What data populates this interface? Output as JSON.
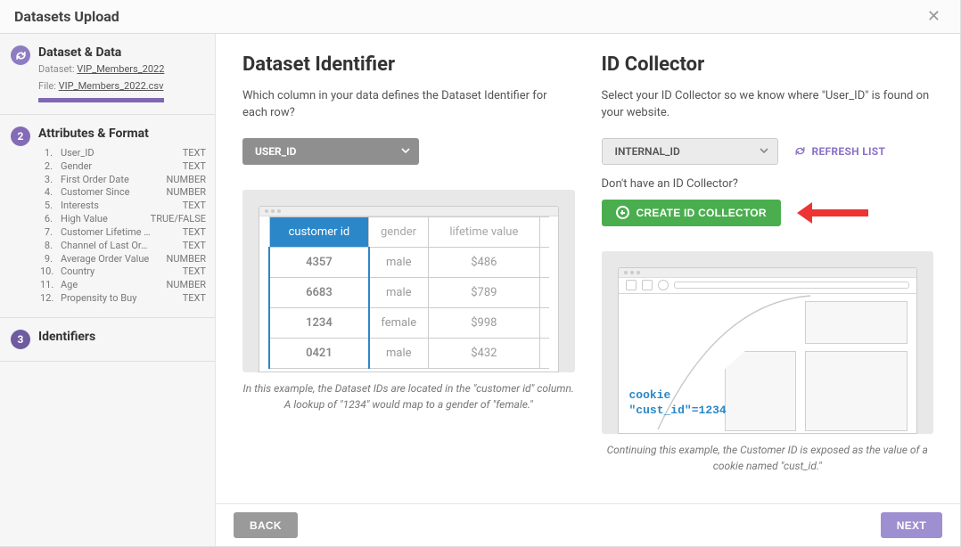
{
  "header": {
    "title": "Datasets Upload"
  },
  "sidebar": {
    "step1": {
      "title": "Dataset & Data",
      "dataset_label": "Dataset:",
      "dataset_value": "VIP_Members_2022",
      "file_label": "File:",
      "file_value": "VIP_Members_2022.csv"
    },
    "step2": {
      "title": "Attributes & Format",
      "number": "2",
      "attributes": [
        {
          "n": "1.",
          "name": "User_ID",
          "type": "TEXT"
        },
        {
          "n": "2.",
          "name": "Gender",
          "type": "TEXT"
        },
        {
          "n": "3.",
          "name": "First Order Date",
          "type": "NUMBER"
        },
        {
          "n": "4.",
          "name": "Customer Since",
          "type": "NUMBER"
        },
        {
          "n": "5.",
          "name": "Interests",
          "type": "TEXT"
        },
        {
          "n": "6.",
          "name": "High Value",
          "type": "TRUE/FALSE"
        },
        {
          "n": "7.",
          "name": "Customer Lifetime …",
          "type": "TEXT"
        },
        {
          "n": "8.",
          "name": "Channel of Last Or…",
          "type": "TEXT"
        },
        {
          "n": "9.",
          "name": "Average Order Value",
          "type": "NUMBER"
        },
        {
          "n": "10.",
          "name": "Country",
          "type": "TEXT"
        },
        {
          "n": "11.",
          "name": "Age",
          "type": "NUMBER"
        },
        {
          "n": "12.",
          "name": "Propensity to Buy",
          "type": "TEXT"
        }
      ]
    },
    "step3": {
      "title": "Identifiers",
      "number": "3"
    }
  },
  "main": {
    "left": {
      "heading": "Dataset Identifier",
      "desc": "Which column in your data defines the Dataset Identifier for each row?",
      "select_value": "USER_ID",
      "table": {
        "headers": [
          "customer id",
          "gender",
          "lifetime value"
        ],
        "rows": [
          [
            "4357",
            "male",
            "$486"
          ],
          [
            "6683",
            "male",
            "$789"
          ],
          [
            "1234",
            "female",
            "$998"
          ],
          [
            "0421",
            "male",
            "$432"
          ]
        ]
      },
      "caption": "In this example, the Dataset IDs are located in the \"customer id\" column. A lookup of \"1234\" would map to a gender of \"female.\""
    },
    "right": {
      "heading": "ID Collector",
      "desc": "Select your ID Collector so we know where \"User_ID\" is found on your website.",
      "select_value": "INTERNAL_ID",
      "refresh_label": "REFRESH LIST",
      "subq": "Don't have an ID Collector?",
      "create_label": "CREATE ID COLLECTOR",
      "code_line1": "cookie",
      "code_line2": "\"cust_id\"=1234",
      "caption": "Continuing this example, the Customer ID is exposed as the value of a cookie named \"cust_id.\""
    }
  },
  "footer": {
    "back": "BACK",
    "next": "NEXT"
  }
}
